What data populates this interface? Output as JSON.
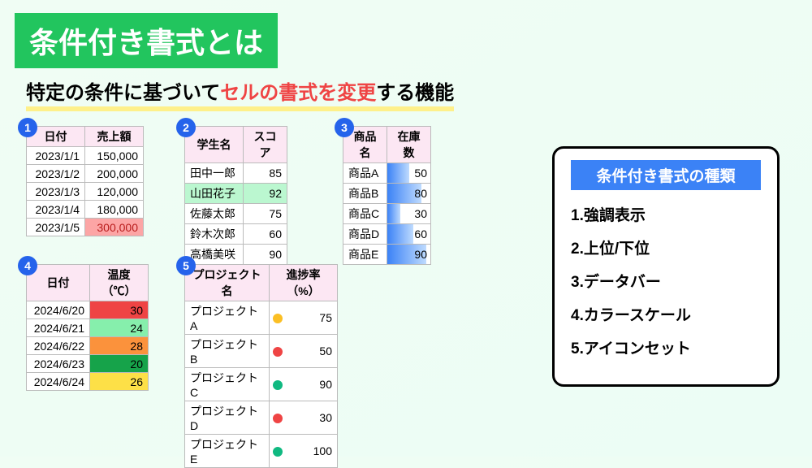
{
  "title": "条件付き書式とは",
  "subtitle_prefix": "特定の条件に基づいて",
  "subtitle_highlight": "セルの書式を変更",
  "subtitle_suffix": "する機能",
  "table1": {
    "num": "1",
    "headers": [
      "日付",
      "売上額"
    ],
    "rows": [
      {
        "date": "2023/1/1",
        "value": "150,000",
        "bg": ""
      },
      {
        "date": "2023/1/2",
        "value": "200,000",
        "bg": ""
      },
      {
        "date": "2023/1/3",
        "value": "120,000",
        "bg": ""
      },
      {
        "date": "2023/1/4",
        "value": "180,000",
        "bg": ""
      },
      {
        "date": "2023/1/5",
        "value": "300,000",
        "bg": "#fca5a5",
        "color": "#b91c1c"
      }
    ]
  },
  "table2": {
    "num": "2",
    "headers": [
      "学生名",
      "スコア"
    ],
    "rows": [
      {
        "name": "田中一郎",
        "score": "85",
        "bg": ""
      },
      {
        "name": "山田花子",
        "score": "92",
        "bg": "#bbf7d0"
      },
      {
        "name": "佐藤太郎",
        "score": "75",
        "bg": ""
      },
      {
        "name": "鈴木次郎",
        "score": "60",
        "bg": ""
      },
      {
        "name": "高橋美咲",
        "score": "90",
        "bg": ""
      }
    ]
  },
  "table3": {
    "num": "3",
    "headers": [
      "商品名",
      "在庫数"
    ],
    "rows": [
      {
        "name": "商品A",
        "stock": "50",
        "pct": 50
      },
      {
        "name": "商品B",
        "stock": "80",
        "pct": 80
      },
      {
        "name": "商品C",
        "stock": "30",
        "pct": 30
      },
      {
        "name": "商品D",
        "stock": "60",
        "pct": 60
      },
      {
        "name": "商品E",
        "stock": "90",
        "pct": 90
      }
    ]
  },
  "table4": {
    "num": "4",
    "headers": [
      "日付",
      "温度（℃）"
    ],
    "rows": [
      {
        "date": "2024/6/20",
        "temp": "30",
        "bg": "#ef4444"
      },
      {
        "date": "2024/6/21",
        "temp": "24",
        "bg": "#86efac"
      },
      {
        "date": "2024/6/22",
        "temp": "28",
        "bg": "#fb923c"
      },
      {
        "date": "2024/6/23",
        "temp": "20",
        "bg": "#16a34a"
      },
      {
        "date": "2024/6/24",
        "temp": "26",
        "bg": "#fde047"
      }
    ]
  },
  "table5": {
    "num": "5",
    "headers": [
      "プロジェクト名",
      "進捗率（%）"
    ],
    "rows": [
      {
        "name": "プロジェクトA",
        "pct": "75",
        "dot": "dot-y"
      },
      {
        "name": "プロジェクトB",
        "pct": "50",
        "dot": "dot-r"
      },
      {
        "name": "プロジェクトC",
        "pct": "90",
        "dot": "dot-g"
      },
      {
        "name": "プロジェクトD",
        "pct": "30",
        "dot": "dot-r"
      },
      {
        "name": "プロジェクトE",
        "pct": "100",
        "dot": "dot-g"
      }
    ]
  },
  "legend": {
    "title": "条件付き書式の種類",
    "items": [
      "1.強調表示",
      "2.上位/下位",
      "3.データバー",
      "4.カラースケール",
      "5.アイコンセット"
    ]
  }
}
